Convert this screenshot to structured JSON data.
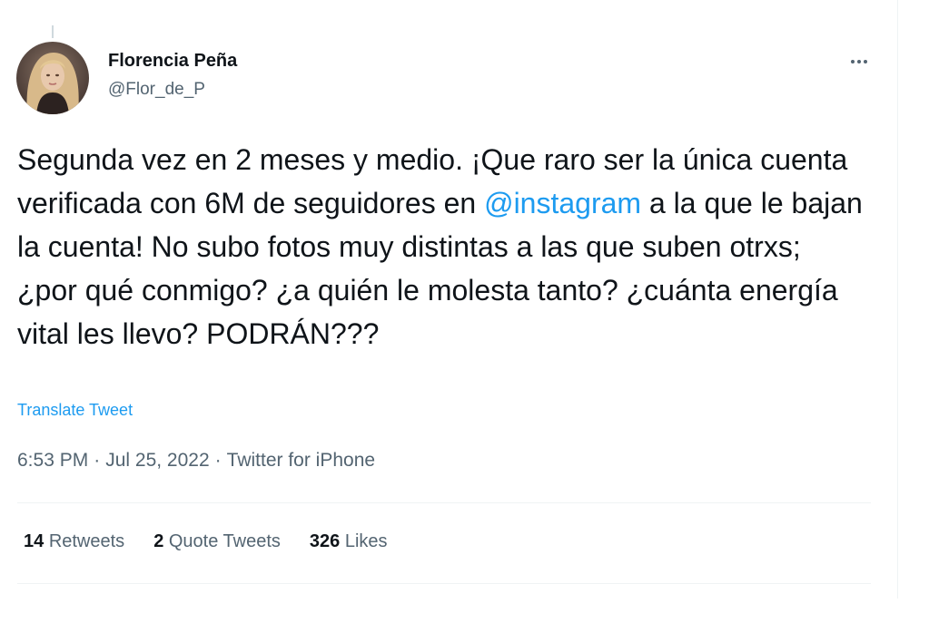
{
  "author": {
    "display_name": "Florencia Peña",
    "handle": "@Flor_de_P"
  },
  "tweet": {
    "text_before_mention": "Segunda vez en 2 meses y medio. ¡Que raro ser la única cuenta verificada con 6M de seguidores en ",
    "mention": "@instagram",
    "text_after_mention": " a la que le bajan la cuenta! No subo fotos muy distintas a las que suben otrxs; ¿por qué conmigo? ¿a quién le molesta tanto? ¿cuánta energía vital les llevo? PODRÁN???",
    "translate_label": "Translate Tweet"
  },
  "meta": {
    "time": "6:53 PM",
    "separator": "·",
    "date": "Jul 25, 2022",
    "source": "Twitter for iPhone"
  },
  "stats": {
    "retweets_count": "14",
    "retweets_label": "Retweets",
    "quote_tweets_count": "2",
    "quote_tweets_label": "Quote Tweets",
    "likes_count": "326",
    "likes_label": "Likes"
  },
  "icons": {
    "more": "more-horizontal-icon"
  },
  "colors": {
    "link": "#1d9bf0",
    "secondary_text": "#536471",
    "primary_text": "#0f1419",
    "divider": "#eff3f4"
  }
}
